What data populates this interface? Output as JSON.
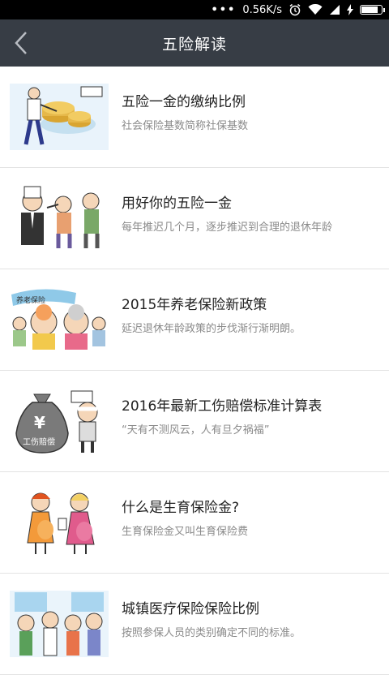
{
  "status_bar": {
    "network_speed": "0.56K/s",
    "alarm_icon": "alarm-icon",
    "wifi_icon": "wifi-icon",
    "signal_icon": "signal-icon",
    "charging_icon": "charging-icon",
    "battery_level": 0.9
  },
  "header": {
    "title": "五险解读",
    "back_icon": "chevron-left-icon"
  },
  "items": [
    {
      "title": "五险一金的缴纳比例",
      "desc": "社会保险基数简称社保基数",
      "image": "coins-cartoon"
    },
    {
      "title": "用好你的五险一金",
      "desc": "每年推迟几个月，逐步推迟到合理的退休年龄",
      "image": "people-discussion-cartoon"
    },
    {
      "title": "2015年养老保险新政策",
      "desc": "延迟退休年龄政策的步伐渐行渐明朗。",
      "image": "elderly-couple-cartoon",
      "image_text": "养老保险"
    },
    {
      "title": "2016年最新工伤赔偿标准计算表",
      "desc": "“天有不测风云，人有旦夕祸福”",
      "image": "injury-money-bag-cartoon",
      "image_text": "工伤赔偿"
    },
    {
      "title": "什么是生育保险金?",
      "desc": "生育保险金又叫生育保险费",
      "image": "pregnant-women-cartoon"
    },
    {
      "title": "城镇医疗保险保险比例",
      "desc": "按照参保人员的类别确定不同的标准。",
      "image": "medical-crowd-cartoon"
    }
  ]
}
